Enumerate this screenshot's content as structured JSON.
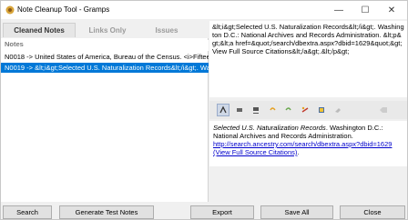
{
  "window": {
    "title": "Note Cleanup Tool - Gramps",
    "min_glyph": "—",
    "max_glyph": "☐",
    "close_glyph": "✕",
    "icon": "gramps-icon"
  },
  "tabs": [
    {
      "label": "Cleaned Notes",
      "active": true
    },
    {
      "label": "Links Only",
      "active": false
    },
    {
      "label": "Issues",
      "active": false
    }
  ],
  "list": {
    "header": "Notes",
    "rows": [
      {
        "text": "N0018 -> United States of America, Bureau of the Census. <i>Fifteen"
      },
      {
        "text": "N0019 -> &lt;i&gt;Selected U.S. Naturalization Records&lt;/i&gt;. Was",
        "selected": true
      }
    ]
  },
  "raw_text": "&lt;i&gt;Selected U.S. Naturalization Records&lt;/i&gt;. Washington D.C.: National Archives and Records Administration. &lt;p&gt;&lt;a href=&quot;/search/dbextra.aspx?dbid=1629&quot;&gt;View Full Source Citations&lt;/a&gt;.&lt;/p&gt;",
  "toolbar_icons": [
    "format-icon",
    "bold-icon",
    "underline-icon",
    "undo-icon",
    "redo-icon",
    "link-icon",
    "clean-icon",
    "eraser-icon",
    "clear-icon"
  ],
  "preview": {
    "italic": "Selected U.S. Naturalization Records",
    "text": ". Washington D.C.: National Archives and Records Administration. ",
    "link": "http://search.ancestry.com/search/dbextra.aspx?dbid=1629 (View Full Source Citations)",
    "tail": "."
  },
  "buttons": {
    "search": "Search",
    "generate": "Generate Test Notes",
    "export": "Export",
    "save_all": "Save All",
    "close": "Close"
  }
}
